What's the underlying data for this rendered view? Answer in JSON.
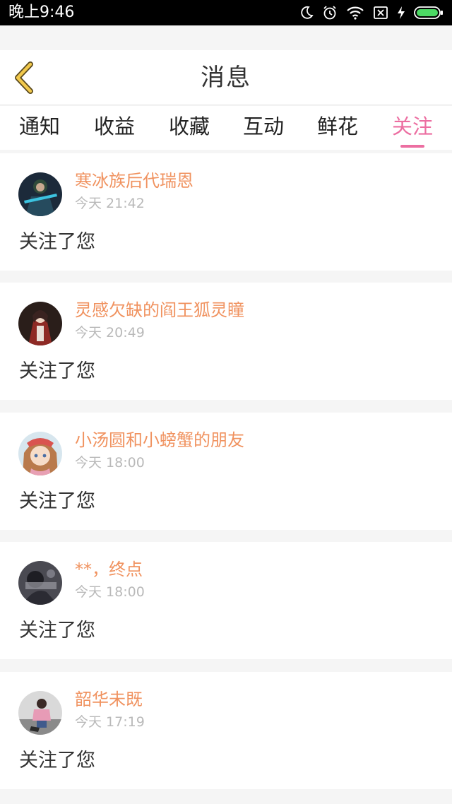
{
  "status_bar": {
    "time": "晚上9:46",
    "icons": [
      "moon-icon",
      "alarm-icon",
      "wifi-icon",
      "sim-off-icon",
      "charging-icon",
      "battery-icon"
    ]
  },
  "header": {
    "back_icon": "chevron-left-icon",
    "title": "消息"
  },
  "tabs": [
    {
      "label": "通知",
      "active": false
    },
    {
      "label": "收益",
      "active": false
    },
    {
      "label": "收藏",
      "active": false
    },
    {
      "label": "互动",
      "active": false
    },
    {
      "label": "鲜花",
      "active": false
    },
    {
      "label": "关注",
      "active": true
    }
  ],
  "messages": [
    {
      "name": "寒冰族后代瑞恩",
      "time": "今天 21:42",
      "text": "关注了您"
    },
    {
      "name": "灵感欠缺的阎王狐灵瞳",
      "time": "今天 20:49",
      "text": "关注了您"
    },
    {
      "name": "小汤圆和小螃蟹的朋友",
      "time": "今天 18:00",
      "text": "关注了您"
    },
    {
      "name": "**，终点",
      "time": "今天 18:00",
      "text": "关注了您"
    },
    {
      "name": "韶华未既",
      "time": "今天 17:19",
      "text": "关注了您"
    }
  ],
  "colors": {
    "accent_pink": "#ec6ea1",
    "username_orange": "#f0925f",
    "back_arrow_yellow": "#f2c94c",
    "battery_green": "#4cd964"
  }
}
